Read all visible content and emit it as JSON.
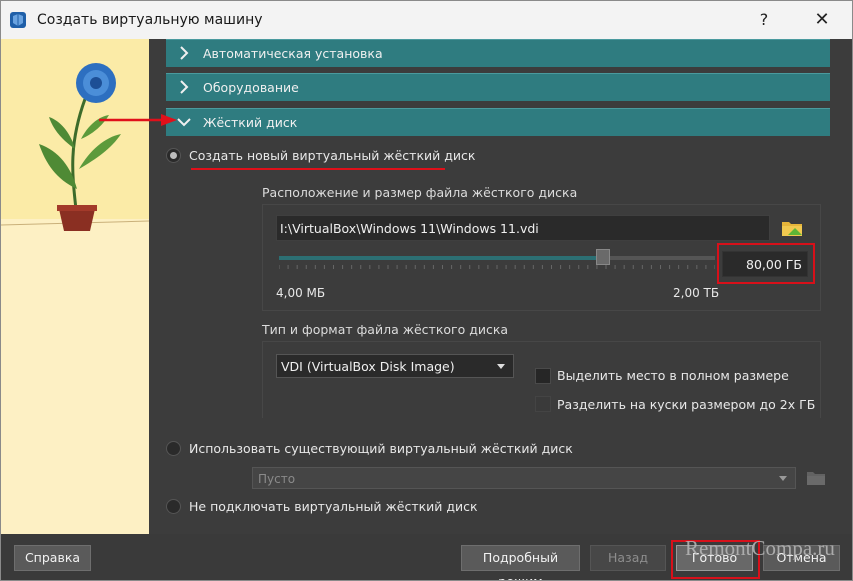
{
  "window": {
    "title": "Создать виртуальную машину",
    "help_symbol": "?",
    "close_symbol": "✕"
  },
  "sections": [
    {
      "label": "Автоматическая установка",
      "expanded": false
    },
    {
      "label": "Оборудование",
      "expanded": false
    },
    {
      "label": "Жёсткий диск",
      "expanded": true
    }
  ],
  "disk": {
    "option_new": "Создать новый виртуальный жёсткий диск",
    "location_label": "Расположение и размер файла жёсткого диска",
    "path_value": "I:\\VirtualBox\\Windows 11\\Windows 11.vdi",
    "size_value": "80,00 ГБ",
    "slider_fraction": 0.744,
    "min_label": "4,00 МБ",
    "max_label": "2,00 ТБ",
    "type_label": "Тип и формат файла жёсткого диска",
    "type_value": "VDI (VirtualBox Disk Image)",
    "preallocate_label": "Выделить место в полном размере",
    "split_label": "Разделить на куски размером до 2х ГБ",
    "option_existing": "Использовать существующий виртуальный жёсткий диск",
    "existing_placeholder": "Пусто",
    "option_none": "Не подключать виртуальный жёсткий диск"
  },
  "buttons": {
    "help": "Справка",
    "expert": "Подробный режим",
    "back": "Назад",
    "finish": "Готово",
    "cancel": "Отмена"
  },
  "watermark": "RemontCompa.ru",
  "colors": {
    "section_bg": "#2f7c80",
    "highlight_red": "#d8101a",
    "panel_bg": "#3c3c3c",
    "illustration_bg": "#fbeba7"
  }
}
